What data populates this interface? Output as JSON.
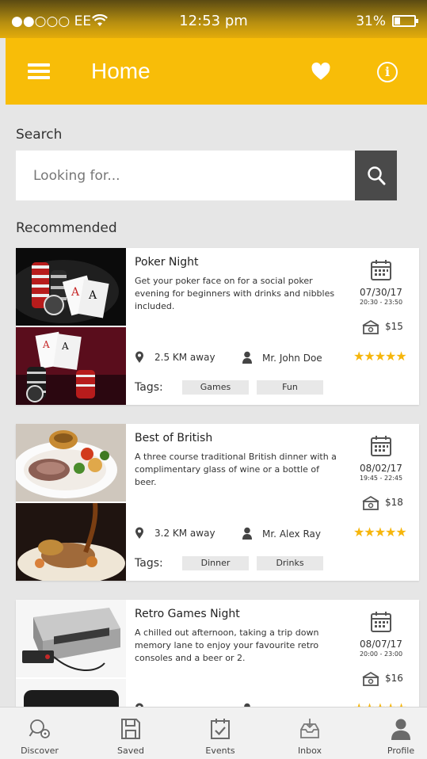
{
  "status_bar": {
    "carrier": "●●○○○ EE",
    "time": "12:53 pm",
    "battery": "31%"
  },
  "app_bar": {
    "title": "Home"
  },
  "search": {
    "label": "Search",
    "placeholder": "Looking for..."
  },
  "recommended_label": "Recommended",
  "events": [
    {
      "name": "Poker Night",
      "description": "Get your poker face on for a social poker evening for beginners with drinks and nibbles included.",
      "date": "07/30/17",
      "hours": "20:30 - 23:50",
      "price": "$15",
      "distance": "2.5 KM away",
      "host": "Mr. John Doe",
      "rating": 5,
      "tags_label": "Tags:",
      "tags": [
        "Games",
        "Fun"
      ]
    },
    {
      "name": "Best of British",
      "description": "A three course traditional British dinner with a complimentary glass of wine or a bottle of beer.",
      "date": "08/02/17",
      "hours": "19:45 - 22:45",
      "price": "$18",
      "distance": "3.2 KM away",
      "host": "Mr. Alex Ray",
      "rating": 5,
      "tags_label": "Tags:",
      "tags": [
        "Dinner",
        "Drinks"
      ]
    },
    {
      "name": "Retro Games Night",
      "description": "A chilled out afternoon, taking a trip down memory lane to enjoy your favourite retro consoles and a beer or 2.",
      "date": "08/07/17",
      "hours": "20:00 - 23:00",
      "price": "$16",
      "distance": "",
      "host": "",
      "rating": 5,
      "tags_label": "",
      "tags": [
        "",
        ""
      ]
    }
  ],
  "tabs": [
    {
      "label": "Discover",
      "icon": "discover-icon"
    },
    {
      "label": "Saved",
      "icon": "saved-icon"
    },
    {
      "label": "Events",
      "icon": "events-icon"
    },
    {
      "label": "Inbox",
      "icon": "inbox-icon"
    },
    {
      "label": "Profile",
      "icon": "profile-icon"
    }
  ],
  "colors": {
    "accent": "#f8bd08",
    "star": "#f6b60c",
    "search_button": "#4a4a4a"
  }
}
